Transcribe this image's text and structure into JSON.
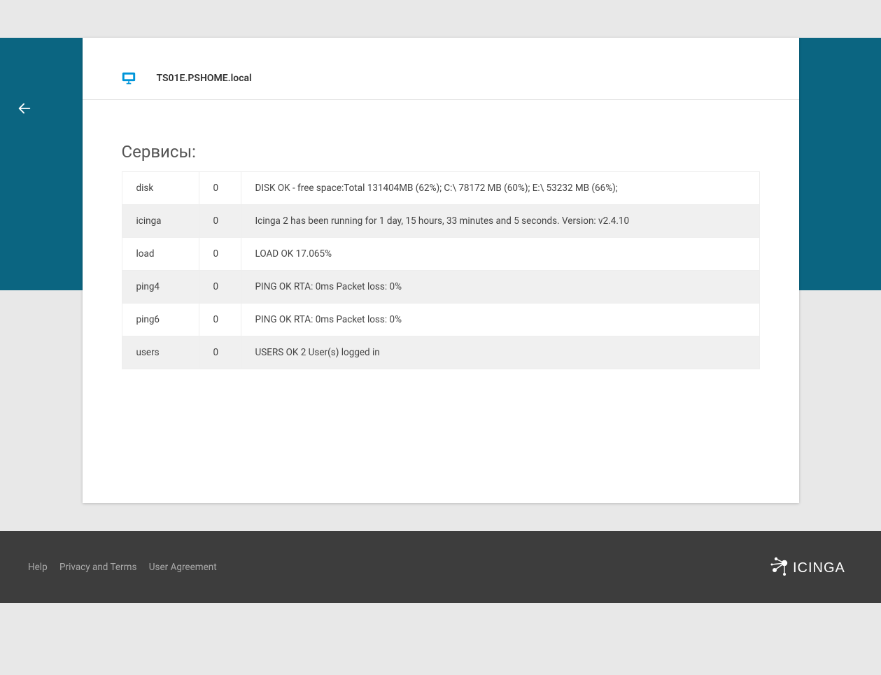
{
  "host": {
    "name": "TS01E.PSHOME.local"
  },
  "section_title": "Сервисы:",
  "services": [
    {
      "name": "disk",
      "count": "0",
      "output": "DISK OK - free space:Total 131404MB (62%); C:\\ 78172 MB (60%); E:\\ 53232 MB (66%);"
    },
    {
      "name": "icinga",
      "count": "0",
      "output": "Icinga 2 has been running for 1 day, 15 hours, 33 minutes and 5 seconds. Version: v2.4.10"
    },
    {
      "name": "load",
      "count": "0",
      "output": "LOAD OK 17.065%"
    },
    {
      "name": "ping4",
      "count": "0",
      "output": "PING OK RTA: 0ms Packet loss: 0%"
    },
    {
      "name": "ping6",
      "count": "0",
      "output": "PING OK RTA: 0ms Packet loss: 0%"
    },
    {
      "name": "users",
      "count": "0",
      "output": "USERS OK 2 User(s) logged in"
    }
  ],
  "footer": {
    "help": "Help",
    "privacy": "Privacy and Terms",
    "agreement": "User Agreement",
    "brand": "ICINGA"
  }
}
